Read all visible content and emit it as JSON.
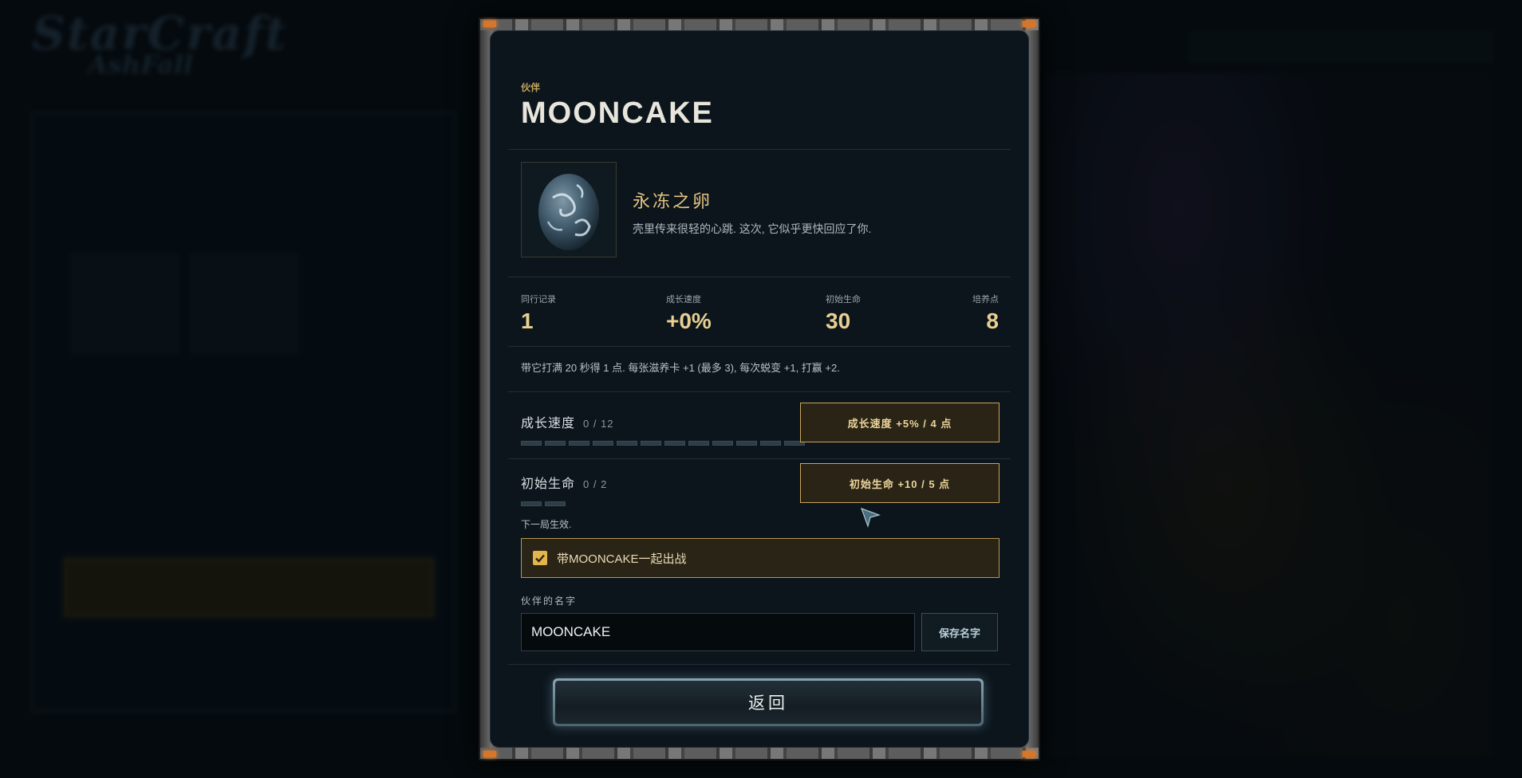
{
  "background": {
    "logo_line1": "StarCraft",
    "logo_line2": "AshFall"
  },
  "modal": {
    "eyebrow": "伙伴",
    "title": "MOONCAKE",
    "pet": {
      "image_icon": "frozen-egg-icon",
      "name": "永冻之卵",
      "description": "壳里传来很轻的心跳. 这次, 它似乎更快回应了你."
    },
    "stats": [
      {
        "label": "同行记录",
        "value": "1"
      },
      {
        "label": "成长速度",
        "value": "+0%"
      },
      {
        "label": "初始生命",
        "value": "30"
      },
      {
        "label": "培养点",
        "value": "8"
      }
    ],
    "rule_text": "带它打满 20 秒得 1 点. 每张滋养卡 +1 (最多 3), 每次蜕变 +1, 打赢 +2.",
    "upgrades": [
      {
        "label": "成长速度",
        "count": "0 / 12",
        "current": 0,
        "max": 12,
        "button": "成长速度 +5% / 4 点"
      },
      {
        "label": "初始生命",
        "count": "0 / 2",
        "current": 0,
        "max": 2,
        "button": "初始生命 +10 / 5 点"
      }
    ],
    "next_note": "下一局生效.",
    "bring_checkbox": {
      "label": "带MOONCAKE一起出战",
      "checked": true
    },
    "name_field": {
      "label": "伙伴的名字",
      "value": "MOONCAKE"
    },
    "save_button": "保存名字",
    "back_button": "返回"
  },
  "colors": {
    "accent_gold": "#e8cf92",
    "button_border": "#c9a459",
    "panel_bg": "#0c151c"
  }
}
